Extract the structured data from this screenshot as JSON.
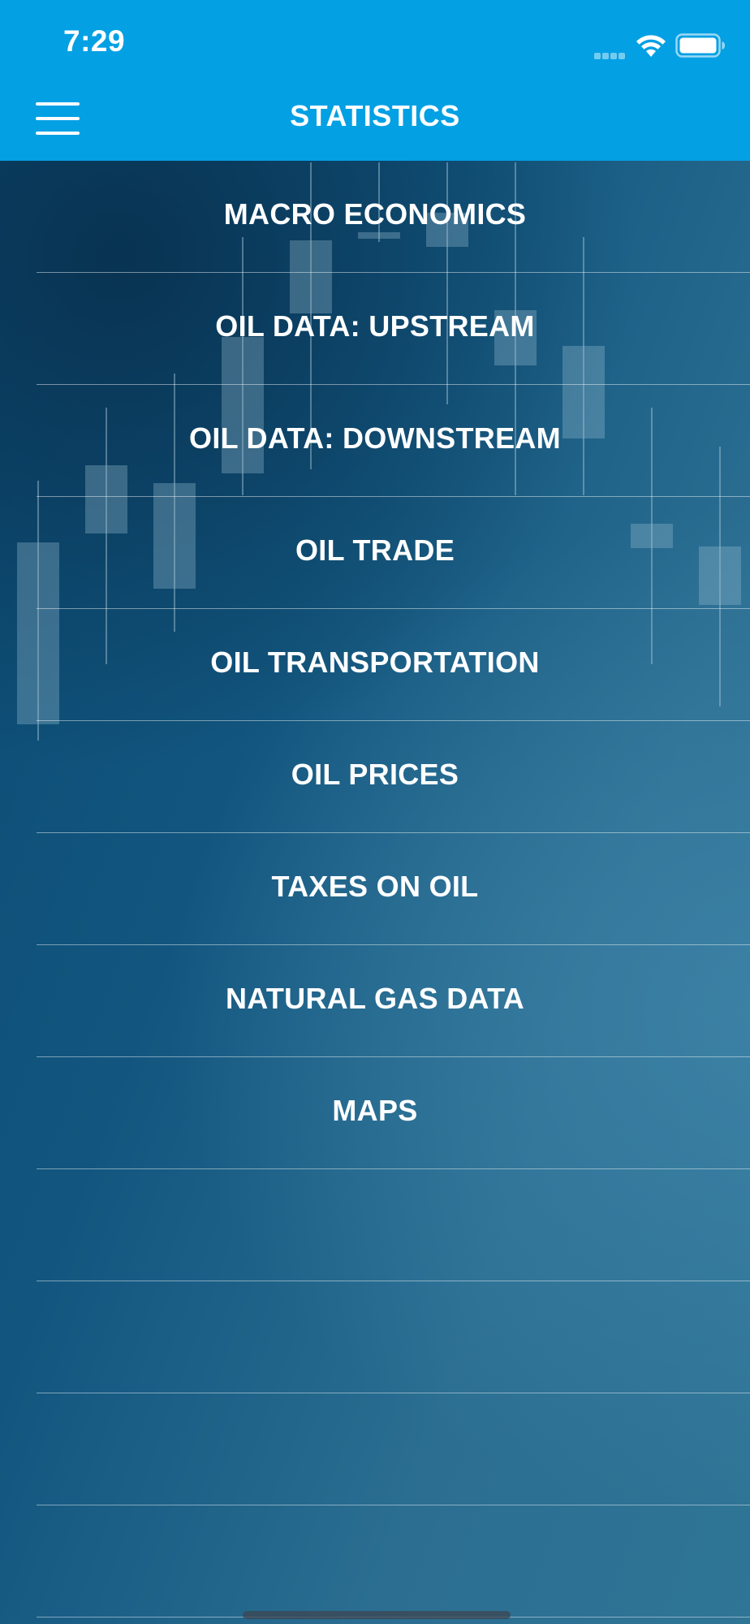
{
  "status_bar": {
    "time": "7:29",
    "signal_icon": "cellular-signal-icon",
    "wifi_icon": "wifi-icon",
    "battery_icon": "battery-icon"
  },
  "header": {
    "title": "STATISTICS",
    "menu_icon": "hamburger-menu-icon",
    "background_color": "#03a0e4"
  },
  "menu": {
    "items": [
      {
        "label": "MACRO ECONOMICS"
      },
      {
        "label": "OIL DATA: UPSTREAM"
      },
      {
        "label": "OIL DATA: DOWNSTREAM"
      },
      {
        "label": "OIL TRADE"
      },
      {
        "label": "OIL TRANSPORTATION"
      },
      {
        "label": "OIL PRICES"
      },
      {
        "label": "TAXES ON OIL"
      },
      {
        "label": "NATURAL GAS DATA"
      },
      {
        "label": "MAPS"
      },
      {
        "label": ""
      },
      {
        "label": ""
      },
      {
        "label": ""
      },
      {
        "label": ""
      }
    ]
  },
  "colors": {
    "text": "#ffffff",
    "content_background": "#1a5f88"
  }
}
